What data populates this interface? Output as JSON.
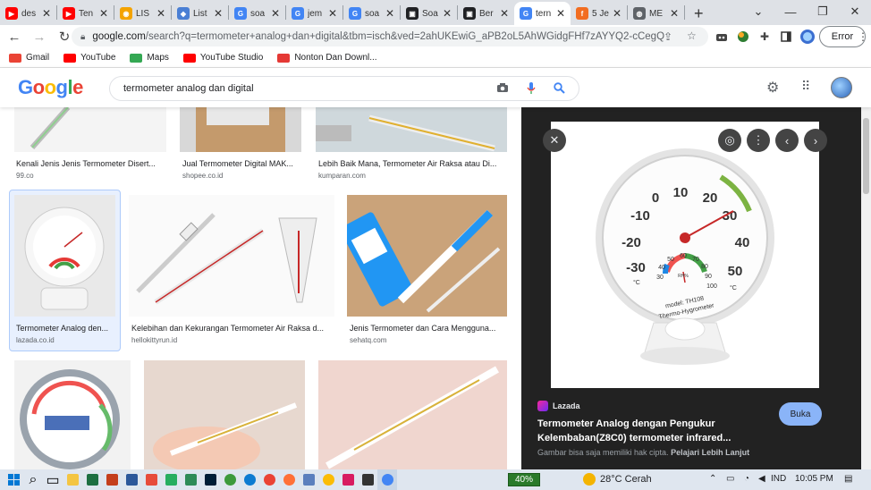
{
  "tabs": [
    {
      "title": "des",
      "color": "#ff0000",
      "glyph": "▶"
    },
    {
      "title": "Ten",
      "color": "#ff0000",
      "glyph": "▶"
    },
    {
      "title": "LIS",
      "color": "#f4a300",
      "glyph": "◉"
    },
    {
      "title": "List",
      "color": "#4a7fd4",
      "glyph": "◆"
    },
    {
      "title": "soa",
      "color": "#4285f4",
      "glyph": "G"
    },
    {
      "title": "jem",
      "color": "#4285f4",
      "glyph": "G"
    },
    {
      "title": "soa",
      "color": "#4285f4",
      "glyph": "G"
    },
    {
      "title": "Soa",
      "color": "#202124",
      "glyph": "▣"
    },
    {
      "title": "Ber",
      "color": "#202124",
      "glyph": "▣"
    },
    {
      "title": "tern",
      "color": "#4285f4",
      "glyph": "G",
      "active": true
    },
    {
      "title": "5 Je",
      "color": "#f26d21",
      "glyph": "f"
    },
    {
      "title": "ME",
      "color": "#5f6368",
      "glyph": "◍"
    }
  ],
  "omnibox": {
    "host": "google.com",
    "path": "/search?q=termometer+analog+dan+digital&tbm=isch&ved=2ahUKEwiG_aPB2oL5AhWGidgFHf7zAYYQ2-cCegQIABAA..."
  },
  "profile_button": "Error",
  "bookmarks": [
    {
      "label": "Gmail",
      "color": "#ea4335"
    },
    {
      "label": "YouTube",
      "color": "#ff0000"
    },
    {
      "label": "Maps",
      "color": "#34a853"
    },
    {
      "label": "YouTube Studio",
      "color": "#ff0000"
    },
    {
      "label": "Nonton Dan Downl...",
      "color": "#e53935"
    }
  ],
  "google": {
    "logo": [
      "G",
      "o",
      "o",
      "g",
      "l",
      "e"
    ],
    "logo_colors": [
      "#4285f4",
      "#ea4335",
      "#fbbc05",
      "#4285f4",
      "#34a853",
      "#ea4335"
    ],
    "query": "termometer analog dan digital"
  },
  "results": [
    {
      "caption": "Kenali Jenis Jenis Termometer Disert...",
      "source": "99.co"
    },
    {
      "caption": "Jual Termometer Digital MAK...",
      "source": "shopee.co.id"
    },
    {
      "caption": "Lebih Baik Mana, Termometer Air Raksa atau Di...",
      "source": "kumparan.com"
    },
    {
      "caption": "Termometer Analog den...",
      "source": "lazada.co.id"
    },
    {
      "caption": "Kelebihan dan Kekurangan Termometer Air Raksa d...",
      "source": "hellokittyrun.id"
    },
    {
      "caption": "Jenis Termometer dan Cara Mengguna...",
      "source": "sehatq.com"
    }
  ],
  "viewer": {
    "source": "Lazada",
    "title": "Termometer Analog dengan Pengukur Kelembaban(Z8C0) termometer infrared...",
    "visit_button": "Buka",
    "footer_text": "Gambar bisa saja memiliki hak cipta.",
    "footer_link": "Pelajari Lebih Lanjut",
    "dial_labels": [
      "0",
      "10",
      "20",
      "30",
      "40",
      "50",
      "-10",
      "-20",
      "-30"
    ],
    "hygro_labels": [
      "30",
      "40",
      "50",
      "60",
      "70",
      "80",
      "90",
      "100"
    ],
    "units": [
      "°C",
      "°C",
      "RH%"
    ],
    "model": "model: TH108",
    "brand": "Thermo-Hygrometer"
  },
  "taskbar": {
    "battery": "40%",
    "weather": "28°C  Cerah",
    "lang": "IND",
    "time": "10:05 PM"
  }
}
